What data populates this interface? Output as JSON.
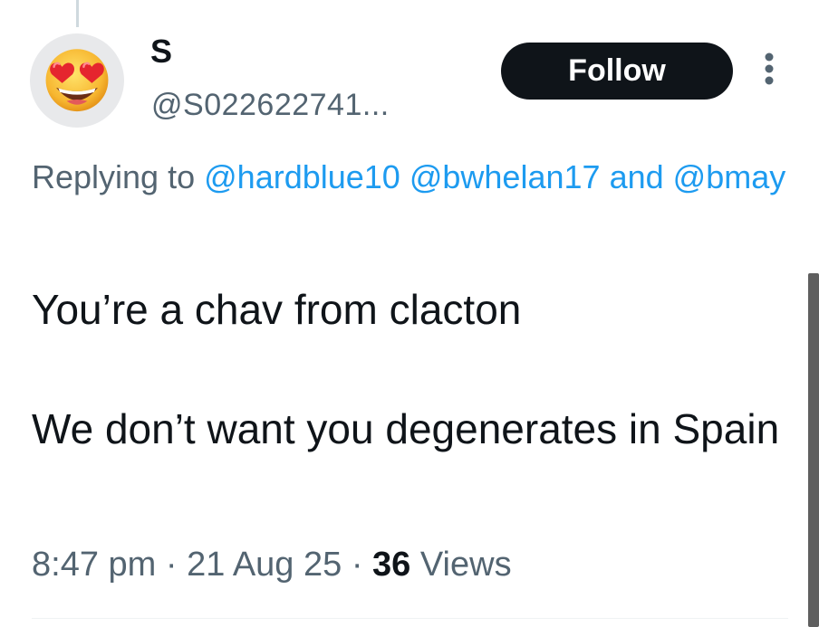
{
  "author": {
    "display_name": "S",
    "handle": "@S022622741...",
    "avatar_icon": "heart-eyes-emoji-icon",
    "avatar_bg": "#e8e9eb"
  },
  "actions": {
    "follow_label": "Follow",
    "more_icon": "more-vertical-icon"
  },
  "reply": {
    "prefix": "Replying to",
    "mentions": [
      "@hardblue10",
      "@bwhelan17"
    ],
    "conjunction": "and",
    "extra_mention": "@bmay"
  },
  "tweet": {
    "paragraphs": [
      "You’re a chav from clacton",
      "We don’t want you degenerates in Spain"
    ]
  },
  "meta": {
    "time": "8:47 pm",
    "separator": "·",
    "date": "21 Aug 25",
    "views_count": "36",
    "views_label": "Views"
  },
  "colors": {
    "text_primary": "#0f1419",
    "text_secondary": "#536471",
    "link": "#1d9bf0",
    "follow_bg": "#0f1419",
    "follow_text": "#ffffff"
  }
}
